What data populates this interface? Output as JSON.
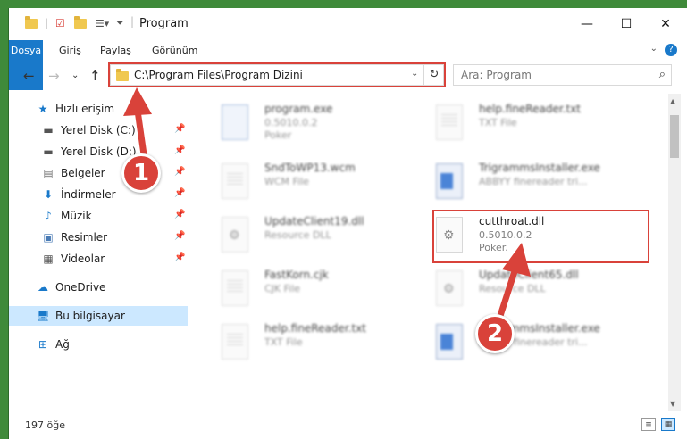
{
  "window": {
    "title": "Program",
    "controls": {
      "minimize": "—",
      "maximize": "☐",
      "close": "✕"
    }
  },
  "ribbon": {
    "tabs": [
      "Dosya",
      "Giriş",
      "Paylaş",
      "Görünüm"
    ],
    "help": "?",
    "collapse": "⌄"
  },
  "address": {
    "path": "C:\\Program Files\\Program Dizini",
    "search_placeholder": "Ara: Program",
    "refresh": "↻",
    "dropdown": "⌄"
  },
  "nav": {
    "back": "←",
    "forward": "→",
    "recent": "⌄",
    "up": "↑"
  },
  "sidebar": {
    "items": [
      {
        "label": "Hızlı erişim",
        "icon": "star-icon"
      },
      {
        "label": "Yerel Disk (C:)",
        "icon": "drive-icon",
        "pinned": true
      },
      {
        "label": "Yerel Disk (D:)",
        "icon": "drive-icon",
        "pinned": true
      },
      {
        "label": "Belgeler",
        "icon": "documents-icon",
        "pinned": true
      },
      {
        "label": "İndirmeler",
        "icon": "downloads-icon",
        "pinned": true
      },
      {
        "label": "Müzik",
        "icon": "music-icon",
        "pinned": true
      },
      {
        "label": "Resimler",
        "icon": "pictures-icon",
        "pinned": true
      },
      {
        "label": "Videolar",
        "icon": "videos-icon",
        "pinned": true
      },
      {
        "label": "OneDrive",
        "icon": "cloud-icon"
      },
      {
        "label": "Bu bilgisayar",
        "icon": "computer-icon",
        "selected": true
      },
      {
        "label": "Ağ",
        "icon": "network-icon"
      }
    ]
  },
  "files": {
    "left": [
      {
        "name": "program.exe",
        "line2": "0.5010.0.2",
        "line3": "Poker",
        "type": "exe"
      },
      {
        "name": "SndToWP13.wcm",
        "line2": "WCM File",
        "line3": "",
        "type": "doc"
      },
      {
        "name": "UpdateClient19.dll",
        "line2": "Resource DLL",
        "line3": "",
        "type": "dll"
      },
      {
        "name": "FastKorn.cjk",
        "line2": "CJK File",
        "line3": "",
        "type": "doc"
      },
      {
        "name": "help.fineReader.txt",
        "line2": "TXT File",
        "line3": "",
        "type": "doc"
      }
    ],
    "right": [
      {
        "name": "help.fineReader.txt",
        "line2": "TXT File",
        "line3": "",
        "type": "doc"
      },
      {
        "name": "TrigrammsInstaller.exe",
        "line2": "ABBYY finereader tri...",
        "line3": "",
        "type": "win-app"
      },
      {
        "name": "cutthroat.dll",
        "line2": "0.5010.0.2",
        "line3": "Poker.",
        "type": "dll",
        "highlight": true
      },
      {
        "name": "UpdateClient65.dll",
        "line2": "Resource DLL",
        "line3": "",
        "type": "dll"
      },
      {
        "name": "TrigrammsInstaller.exe",
        "line2": "ABBYY finereader tri...",
        "line3": "",
        "type": "win-app"
      }
    ]
  },
  "status": {
    "count": "197 öğe"
  },
  "annotations": {
    "step1": "1",
    "step2": "2"
  },
  "colors": {
    "accent": "#1979ca",
    "annotation": "#d9423a",
    "selection": "#cce8ff"
  }
}
